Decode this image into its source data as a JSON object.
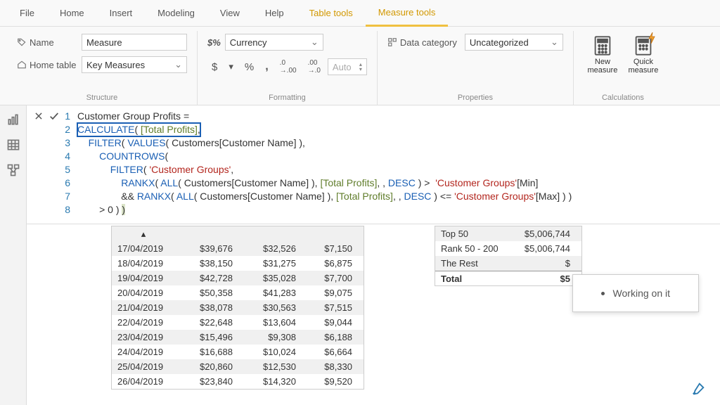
{
  "menubar": {
    "file": "File",
    "home": "Home",
    "insert": "Insert",
    "modeling": "Modeling",
    "view": "View",
    "help": "Help",
    "table_tools": "Table tools",
    "measure_tools": "Measure tools"
  },
  "ribbon": {
    "structure": {
      "label": "Structure",
      "name_label": "Name",
      "name_value": "Measure",
      "home_table_label": "Home table",
      "home_table_value": "Key Measures"
    },
    "formatting": {
      "label": "Formatting",
      "format_icon": "$%",
      "format_value": "Currency",
      "dollar": "$",
      "percent": "%",
      "comma": ",",
      "dec_inc": ".00",
      "dec_dec": ".0",
      "auto": "Auto"
    },
    "properties": {
      "label": "Properties",
      "data_category_label": "Data category",
      "data_category_value": "Uncategorized"
    },
    "calculations": {
      "label": "Calculations",
      "new_measure": "New measure",
      "quick_measure": "Quick measure"
    }
  },
  "formula": {
    "lines": [
      {
        "n": "1",
        "html": "Customer Group Profits ="
      },
      {
        "n": "2",
        "html": "<span class='kw'>CALCULATE</span>( <span class='ref'>[Total Profits]</span>,",
        "boxed": true
      },
      {
        "n": "3",
        "html": "    <span class='kw'>FILTER</span>( <span class='kw'>VALUES</span>( Customers[Customer Name] ),"
      },
      {
        "n": "4",
        "html": "        <span class='kw'>COUNTROWS</span>("
      },
      {
        "n": "5",
        "html": "            <span class='kw'>FILTER</span>( <span class='str'>'Customer Groups'</span>,"
      },
      {
        "n": "6",
        "html": "                <span class='kw'>RANKX</span>( <span class='kw'>ALL</span>( Customers[Customer Name] ), <span class='ref'>[Total Profits]</span>, , <span class='kw'>DESC</span> ) >  <span class='str'>'Customer Groups'</span>[Min]"
      },
      {
        "n": "7",
        "html": "                && <span class='kw'>RANKX</span>( <span class='kw'>ALL</span>( Customers[Customer Name] ), <span class='ref'>[Total Profits]</span>, , <span class='kw'>DESC</span> ) <= <span class='str'>'Customer Groups'</span>[Max] ) )"
      },
      {
        "n": "8",
        "html": "        > 0 ) <span style='background:#dbe4c8'>)</span>"
      }
    ]
  },
  "table_left": {
    "cols": [
      90,
      90,
      90,
      80
    ],
    "rows": [
      [
        "17/04/2019",
        "$39,676",
        "$32,526",
        "$7,150"
      ],
      [
        "18/04/2019",
        "$38,150",
        "$31,275",
        "$6,875"
      ],
      [
        "19/04/2019",
        "$42,728",
        "$35,028",
        "$7,700"
      ],
      [
        "20/04/2019",
        "$50,358",
        "$41,283",
        "$9,075"
      ],
      [
        "21/04/2019",
        "$38,078",
        "$30,563",
        "$7,515"
      ],
      [
        "22/04/2019",
        "$22,648",
        "$13,604",
        "$9,044"
      ],
      [
        "23/04/2019",
        "$15,496",
        "$9,308",
        "$6,188"
      ],
      [
        "24/04/2019",
        "$16,688",
        "$10,024",
        "$6,664"
      ],
      [
        "25/04/2019",
        "$20,860",
        "$12,530",
        "$8,330"
      ],
      [
        "26/04/2019",
        "$23,840",
        "$14,320",
        "$9,520"
      ]
    ]
  },
  "table_right": {
    "cols": [
      110,
      90
    ],
    "rows": [
      [
        "Top 50",
        "$5,006,744"
      ],
      [
        "Rank 50 - 200",
        "$5,006,744"
      ],
      [
        "The Rest",
        "$"
      ]
    ],
    "total_label": "Total",
    "total_value": "$5"
  },
  "popup": {
    "text": "Working on it"
  }
}
